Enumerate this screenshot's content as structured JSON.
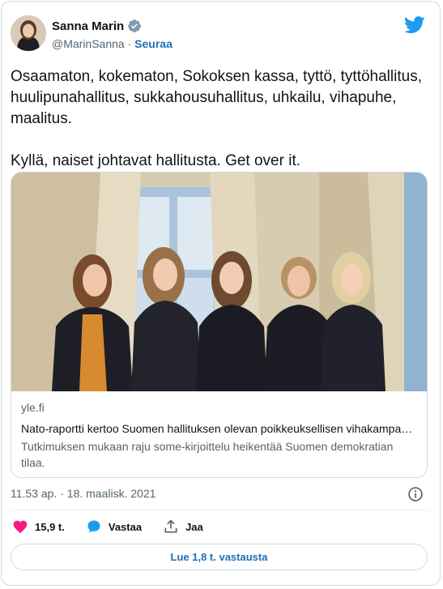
{
  "author": {
    "name": "Sanna Marin",
    "handle": "@MarinSanna",
    "separator": " · ",
    "follow_label": "Seuraa"
  },
  "tweet": {
    "text": "Osaamaton, kokematon, Sokoksen kassa, tyttö, tyttöhallitus, huulipunahallitus, sukkahousuhallitus, uhkailu, vihapuhe, maalitus.\n\nKyllä, naiset johtavat hallitusta. Get over it."
  },
  "link_card": {
    "domain": "yle.fi",
    "title": "Nato-raportti kertoo Suomen hallituksen olevan poikkeuksellisen vihakampanjan kohteena",
    "description": "Tutkimuksen mukaan raju some-kirjoittelu heikentää Suomen demokratian tilaa."
  },
  "timestamp": "11.53 ap. · 18. maalisk. 2021",
  "actions": {
    "likes": "15,9 t.",
    "reply_label": "Vastaa",
    "share_label": "Jaa"
  },
  "replies_button": "Lue 1,8 t. vastausta",
  "colors": {
    "accent": "#1d9bf0",
    "link_text": "#1d70b8",
    "like": "#f91880",
    "reply": "#1d9bf0"
  },
  "icons": [
    "verified-badge-icon",
    "twitter-bird-icon",
    "info-icon",
    "heart-icon",
    "reply-bubble-icon",
    "share-icon"
  ]
}
